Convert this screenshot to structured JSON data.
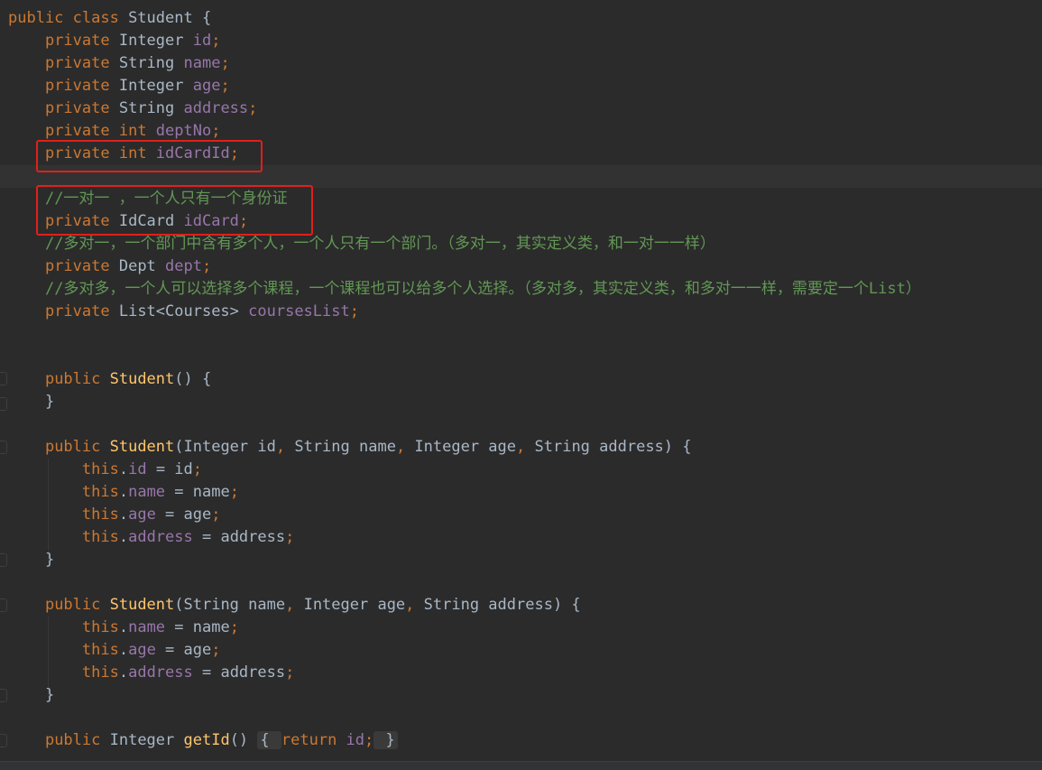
{
  "code": {
    "l1": {
      "a": "public class ",
      "b": "Student {"
    },
    "l2": {
      "kw": "private ",
      "t": "Integer ",
      "f": "id",
      "p": ";"
    },
    "l3": {
      "kw": "private ",
      "t": "String ",
      "f": "name",
      "p": ";"
    },
    "l4": {
      "kw": "private ",
      "t": "Integer ",
      "f": "age",
      "p": ";"
    },
    "l5": {
      "kw": "private ",
      "t": "String ",
      "f": "address",
      "p": ";"
    },
    "l6": {
      "kw1": "private ",
      "kw2": "int ",
      "f": "deptNo",
      "p": ";"
    },
    "l7": {
      "kw1": "private ",
      "kw2": "int ",
      "f": "idCardId",
      "p": ";"
    },
    "l9": {
      "c": "//一对一 ，一个人只有一个身份证"
    },
    "l10": {
      "kw": "private ",
      "t": "IdCard ",
      "f": "idCard",
      "p": ";"
    },
    "l11": {
      "c": "//多对一，一个部门中含有多个人，一个人只有一个部门。（多对一，其实定义类，和一对一一样）"
    },
    "l12": {
      "kw": "private ",
      "t": "Dept ",
      "f": "dept",
      "p": ";"
    },
    "l13": {
      "c": "//多对多，一个人可以选择多个课程，一个课程也可以给多个人选择。（多对多，其实定义类，和多对一一样，需要定一个List）"
    },
    "l14": {
      "kw": "private ",
      "t": "List<Courses> ",
      "f": "coursesList",
      "p": ";"
    },
    "l17": {
      "kw": "public ",
      "fn": "Student",
      "p": "() {"
    },
    "l18": {
      "p": "}"
    },
    "l20": {
      "kw": "public ",
      "fn": "Student",
      "p1": "(Integer id",
      "c1": ", ",
      "p2": "String name",
      "c2": ", ",
      "p3": "Integer age",
      "c3": ", ",
      "p4": "String address) {"
    },
    "l21": {
      "th": "this",
      "d": ".",
      "f": "id",
      "r": " = id",
      "p": ";"
    },
    "l22": {
      "th": "this",
      "d": ".",
      "f": "name",
      "r": " = name",
      "p": ";"
    },
    "l23": {
      "th": "this",
      "d": ".",
      "f": "age",
      "r": " = age",
      "p": ";"
    },
    "l24": {
      "th": "this",
      "d": ".",
      "f": "address",
      "r": " = address",
      "p": ";"
    },
    "l25": {
      "p": "}"
    },
    "l27": {
      "kw": "public ",
      "fn": "Student",
      "p1": "(String name",
      "c1": ", ",
      "p2": "Integer age",
      "c2": ", ",
      "p3": "String address) {"
    },
    "l28": {
      "th": "this",
      "d": ".",
      "f": "name",
      "r": " = name",
      "p": ";"
    },
    "l29": {
      "th": "this",
      "d": ".",
      "f": "age",
      "r": " = age",
      "p": ";"
    },
    "l30": {
      "th": "this",
      "d": ".",
      "f": "address",
      "r": " = address",
      "p": ";"
    },
    "l31": {
      "p": "}"
    },
    "l33": {
      "kw": "public ",
      "t": "Integer ",
      "fn": "getId",
      "p": "() ",
      "b1": "{ ",
      "ret": "return ",
      "f": "id",
      "semi": ";",
      "b2": " }"
    }
  },
  "colors": {
    "background": "#2b2b2b",
    "keyword": "#cc7832",
    "field": "#9876aa",
    "method": "#ffc66d",
    "comment": "#629755",
    "text": "#a9b7c6",
    "highlight_box": "#e0201a"
  }
}
